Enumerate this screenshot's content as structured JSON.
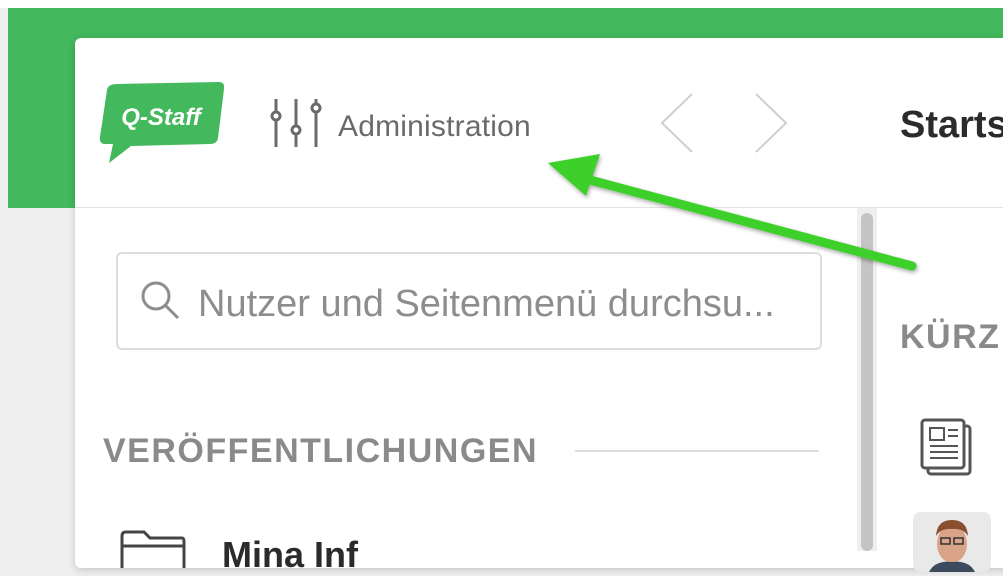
{
  "header": {
    "logo_text": "Q-Staff",
    "admin_label": "Administration",
    "page_title": "Starts"
  },
  "sidebar": {
    "search": {
      "placeholder": "Nutzer und Seitenmenü durchsu..."
    },
    "section_title": "VERÖFFENTLICHUNGEN",
    "items": [
      {
        "label": "Mina Inf"
      }
    ]
  },
  "main": {
    "section_title": "KÜRZ"
  },
  "colors": {
    "brand_green": "#43b85c",
    "arrow_green": "#3ecf2a"
  },
  "icons": [
    "sliders-icon",
    "chevron-left-icon",
    "chevron-right-icon",
    "search-icon",
    "news-document-icon",
    "folder-icon"
  ]
}
